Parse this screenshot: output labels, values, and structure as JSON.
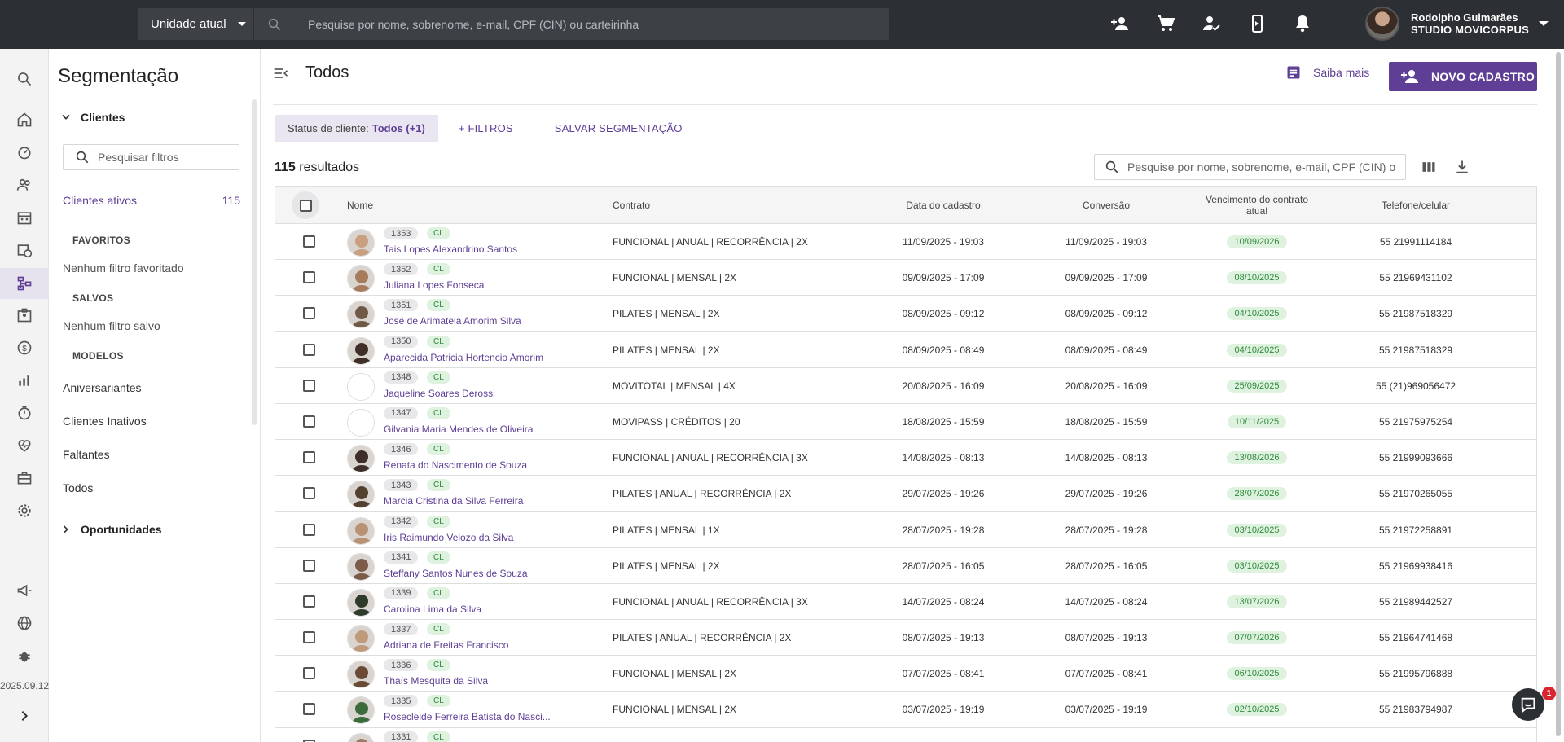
{
  "topbar": {
    "unit_label": "Unidade atual",
    "search_placeholder": "Pesquise por nome, sobrenome, e-mail, CPF (CIN) ou carteirinha",
    "icons": [
      "add-person-icon",
      "cart-icon",
      "person-check-icon",
      "phone-notification-icon",
      "bell-icon"
    ],
    "user_name": "Rodolpho Guimarães",
    "studio_name": "STUDIO MOVICORPUS"
  },
  "rail": {
    "icons": [
      "search-icon",
      "home-icon",
      "dashboard-icon",
      "people-icon",
      "calendar-icon",
      "calendar-clock-icon",
      "segmentation-icon",
      "badge-icon",
      "dollar-icon",
      "chart-icon",
      "timer-icon",
      "heart-pulse-icon",
      "briefcase-icon",
      "gear-icon",
      "megaphone-icon",
      "globe-icon",
      "bug-icon"
    ],
    "version": "2025.09.12"
  },
  "segmentation": {
    "title": "Segmentação",
    "clients_section": "Clientes",
    "filter_placeholder": "Pesquisar filtros",
    "active_label": "Clientes ativos",
    "active_count": "115",
    "favorites_label": "FAVORITOS",
    "favorites_empty": "Nenhum filtro favoritado",
    "saved_label": "SALVOS",
    "saved_empty": "Nenhum filtro salvo",
    "models_label": "MODELOS",
    "models": [
      "Aniversariantes",
      "Clientes Inativos",
      "Faltantes",
      "Todos"
    ],
    "opportunities_section": "Oportunidades"
  },
  "main": {
    "title": "Todos",
    "saiba_mais": "Saiba mais",
    "novo_cadastro": "NOVO CADASTRO",
    "status_chip_label": "Status de cliente:",
    "status_chip_value": "Todos (+1)",
    "filters_link": "+ FILTROS",
    "save_link": "SALVAR SEGMENTAÇÃO",
    "results_count": "115",
    "results_label": "resultados",
    "list_search_placeholder": "Pesquise por nome, sobrenome, e-mail, CPF (CIN) ou carteirinha"
  },
  "table": {
    "headers": {
      "name": "Nome",
      "contract": "Contrato",
      "created": "Data do cadastro",
      "conversion": "Conversão",
      "due": "Vencimento do contrato atual",
      "phone": "Telefone/celular"
    },
    "rows": [
      {
        "code": "1353",
        "tag": "CL",
        "name": "Tais Lopes Alexandrino Santos",
        "contract": "FUNCIONAL | ANUAL | RECORRÊNCIA | 2X",
        "created": "11/09/2025 - 19:03",
        "conversion": "11/09/2025 - 19:03",
        "due": "10/09/2026",
        "phone": "55 21991114184"
      },
      {
        "code": "1352",
        "tag": "CL",
        "name": "Juliana Lopes Fonseca",
        "contract": "FUNCIONAL | MENSAL | 2X",
        "created": "09/09/2025 - 17:09",
        "conversion": "09/09/2025 - 17:09",
        "due": "08/10/2025",
        "phone": "55 21969431102"
      },
      {
        "code": "1351",
        "tag": "CL",
        "name": "José de Arimateia Amorim Silva",
        "contract": "PILATES | MENSAL | 2X",
        "created": "08/09/2025 - 09:12",
        "conversion": "08/09/2025 - 09:12",
        "due": "04/10/2025",
        "phone": "55 21987518329"
      },
      {
        "code": "1350",
        "tag": "CL",
        "name": "Aparecida Patricia Hortencio Amorim",
        "contract": "PILATES | MENSAL | 2X",
        "created": "08/09/2025 - 08:49",
        "conversion": "08/09/2025 - 08:49",
        "due": "04/10/2025",
        "phone": "55 21987518329"
      },
      {
        "code": "1348",
        "tag": "CL",
        "name": "Jaqueline Soares Derossi",
        "contract": "MOVITOTAL | MENSAL | 4X",
        "created": "20/08/2025 - 16:09",
        "conversion": "20/08/2025 - 16:09",
        "due": "25/09/2025",
        "phone": "55 (21)969056472"
      },
      {
        "code": "1347",
        "tag": "CL",
        "name": "Gilvania Maria Mendes de Oliveira",
        "contract": "MOVIPASS | CRÉDITOS | 20",
        "created": "18/08/2025 - 15:59",
        "conversion": "18/08/2025 - 15:59",
        "due": "10/11/2025",
        "phone": "55 21975975254"
      },
      {
        "code": "1346",
        "tag": "CL",
        "name": "Renata do Nascimento de Souza",
        "contract": "FUNCIONAL | ANUAL | RECORRÊNCIA | 3X",
        "created": "14/08/2025 - 08:13",
        "conversion": "14/08/2025 - 08:13",
        "due": "13/08/2026",
        "phone": "55 21999093666"
      },
      {
        "code": "1343",
        "tag": "CL",
        "name": "Marcia Cristina da Silva Ferreira",
        "contract": "PILATES | ANUAL | RECORRÊNCIA | 2X",
        "created": "29/07/2025 - 19:26",
        "conversion": "29/07/2025 - 19:26",
        "due": "28/07/2026",
        "phone": "55 21970265055"
      },
      {
        "code": "1342",
        "tag": "CL",
        "name": "Iris Raimundo Velozo da Silva",
        "contract": "PILATES | MENSAL | 1X",
        "created": "28/07/2025 - 19:28",
        "conversion": "28/07/2025 - 19:28",
        "due": "03/10/2025",
        "phone": "55 21972258891"
      },
      {
        "code": "1341",
        "tag": "CL",
        "name": "Steffany Santos Nunes de Souza",
        "contract": "PILATES | MENSAL | 2X",
        "created": "28/07/2025 - 16:05",
        "conversion": "28/07/2025 - 16:05",
        "due": "03/10/2025",
        "phone": "55 21969938416"
      },
      {
        "code": "1339",
        "tag": "CL",
        "name": "Carolina Lima da Silva",
        "contract": "FUNCIONAL | ANUAL | RECORRÊNCIA | 3X",
        "created": "14/07/2025 - 08:24",
        "conversion": "14/07/2025 - 08:24",
        "due": "13/07/2026",
        "phone": "55 21989442527"
      },
      {
        "code": "1337",
        "tag": "CL",
        "name": "Adriana de Freitas Francisco",
        "contract": "PILATES | ANUAL | RECORRÊNCIA | 2X",
        "created": "08/07/2025 - 19:13",
        "conversion": "08/07/2025 - 19:13",
        "due": "07/07/2026",
        "phone": "55 21964741468"
      },
      {
        "code": "1336",
        "tag": "CL",
        "name": "Thaís Mesquita da Silva",
        "contract": "FUNCIONAL | MENSAL | 2X",
        "created": "07/07/2025 - 08:41",
        "conversion": "07/07/2025 - 08:41",
        "due": "06/10/2025",
        "phone": "55 21995796888"
      },
      {
        "code": "1335",
        "tag": "CL",
        "name": "Rosecleide Ferreira Batista do Nasci...",
        "contract": "FUNCIONAL | MENSAL | 2X",
        "created": "03/07/2025 - 19:19",
        "conversion": "03/07/2025 - 19:19",
        "due": "02/10/2025",
        "phone": "55 21983794987"
      },
      {
        "code": "1331",
        "tag": "CL",
        "name": "",
        "contract": "",
        "created": "",
        "conversion": "",
        "due": "",
        "phone": ""
      }
    ]
  },
  "chat": {
    "badge": "1"
  },
  "colors": {
    "accent": "#5e3f95",
    "topbar": "#2c2f33",
    "success_bg": "#dff2e0",
    "success_text": "#2e8a3b"
  }
}
